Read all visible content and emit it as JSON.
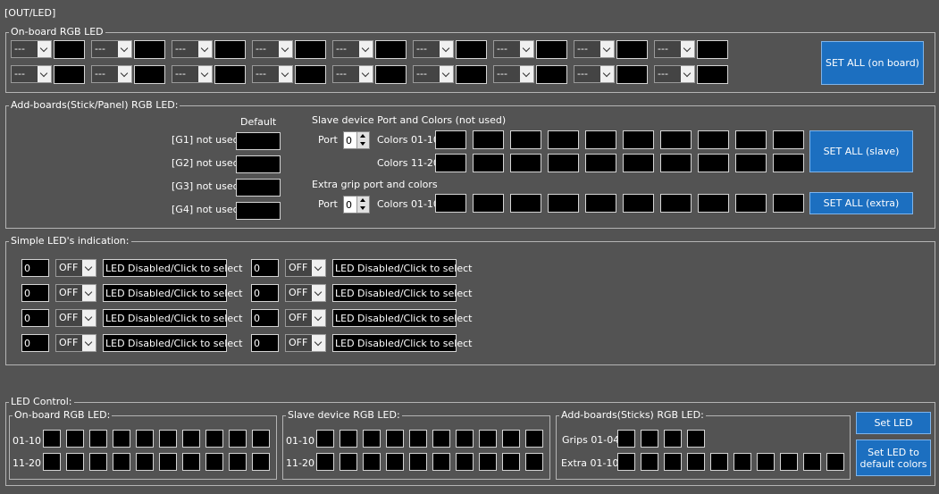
{
  "window_title": "[OUT/LED]",
  "onboard": {
    "title": "On-board RGB LED",
    "combo_value": "---",
    "set_all": "SET ALL (on board)"
  },
  "addboards": {
    "title": "Add-boards(Stick/Panel) RGB LED:",
    "default_label": "Default",
    "groups": [
      "[G1] not used",
      "[G2] not used",
      "[G3] not used",
      "[G4] not used"
    ],
    "slave_title": "Slave device Port and Colors (not used)",
    "port_label": "Port",
    "slave_port_value": "0",
    "colors_01_10": "Colors 01-10",
    "colors_11_20": "Colors 11-20",
    "extra_title": "Extra grip port and colors",
    "extra_port_value": "0",
    "set_all_slave": "SET ALL (slave)",
    "set_all_extra": "SET ALL (extra)"
  },
  "simple": {
    "title": "Simple LED's indication:",
    "rows": [
      {
        "value": "0",
        "state": "OFF",
        "label": "LED Disabled/Click to select"
      },
      {
        "value": "0",
        "state": "OFF",
        "label": "LED Disabled/Click to select"
      },
      {
        "value": "0",
        "state": "OFF",
        "label": "LED Disabled/Click to select"
      },
      {
        "value": "0",
        "state": "OFF",
        "label": "LED Disabled/Click to select"
      },
      {
        "value": "0",
        "state": "OFF",
        "label": "LED Disabled/Click to select"
      },
      {
        "value": "0",
        "state": "OFF",
        "label": "LED Disabled/Click to select"
      },
      {
        "value": "0",
        "state": "OFF",
        "label": "LED Disabled/Click to select"
      },
      {
        "value": "0",
        "state": "OFF",
        "label": "LED Disabled/Click to select"
      }
    ]
  },
  "control": {
    "title": "LED Control:",
    "onboard_title": "On-board RGB LED:",
    "slave_title": "Slave device RGB LED:",
    "addboards_title": "Add-boards(Sticks) RGB LED:",
    "row_01_10": "01-10",
    "row_11_20": "11-20",
    "grips_label": "Grips 01-04",
    "extra_label": "Extra 01-10",
    "set_led": "Set LED",
    "set_default": "Set LED to default colors"
  }
}
